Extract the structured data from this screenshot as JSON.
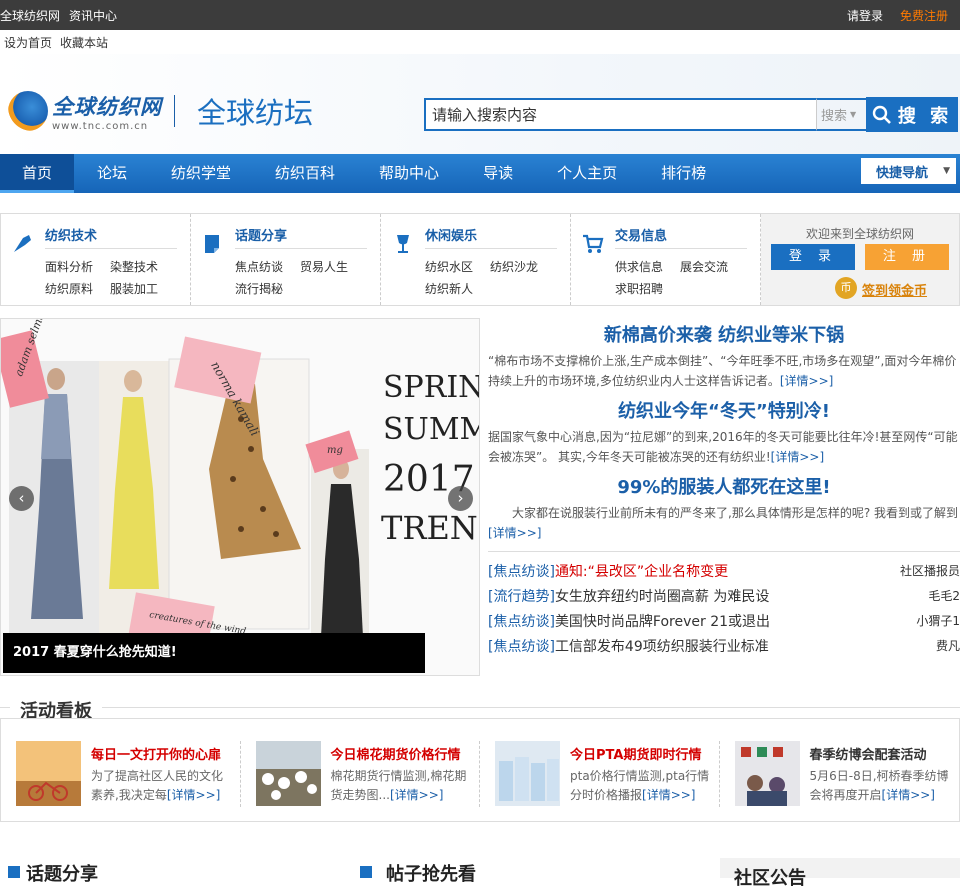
{
  "topbar": {
    "left": [
      "全球纺织网",
      "资讯中心"
    ],
    "login": "请登录",
    "register": "免费注册"
  },
  "subbar": [
    "设为首页",
    "收藏本站"
  ],
  "header": {
    "logo_cn": "全球纺织网",
    "logo_en": "www.tnc.com.cn",
    "forum_name": "全球纺坛",
    "search_value": "请输入搜索内容",
    "search_select": "搜索",
    "search_button": "搜 索"
  },
  "nav": {
    "items": [
      "首页",
      "论坛",
      "纺织学堂",
      "纺织百科",
      "帮助中心",
      "导读",
      "个人主页",
      "排行榜"
    ],
    "quick": "快捷导航"
  },
  "categories": [
    {
      "title": "纺织技术",
      "links": [
        "面料分析",
        "染整技术",
        "纺织原料",
        "服装加工"
      ]
    },
    {
      "title": "话题分享",
      "links": [
        "焦点纺谈",
        "贸易人生",
        "流行揭秘"
      ]
    },
    {
      "title": "休闲娱乐",
      "links": [
        "纺织水区",
        "纺织沙龙",
        "纺织新人"
      ]
    },
    {
      "title": "交易信息",
      "links": [
        "供求信息",
        "展会交流",
        "求职招聘"
      ]
    }
  ],
  "welcome": {
    "text": "欢迎来到全球纺织网",
    "login": "登 录",
    "register": "注 册",
    "coin": "币",
    "sign": "签到领金币"
  },
  "slider": {
    "caption": "2017 春夏穿什么抢先知道!",
    "prev": "‹",
    "next": "›",
    "art": {
      "spring": "SPRING-",
      "summer": "SUMMER",
      "year": "2017",
      "trends": "TRENDS",
      "tag1": "adam selman",
      "tag2": "norma kamali",
      "tag3": "mg",
      "tag4": "creatures of the wind"
    }
  },
  "news": [
    {
      "headline": "新棉高价来袭 纺织业等米下锅",
      "text": "“棉布市场不支撑棉价上涨,生产成本倒挂”、“今年旺季不旺,市场多在观望”,面对今年棉价持续上升的市场环境,多位纺织业内人士这样告诉记者。",
      "more": "[详情>>]"
    },
    {
      "headline": "纺织业今年“冬天”特别冷!",
      "text": "据国家气象中心消息,因为“拉尼娜”的到来,2016年的冬天可能要比往年冷!甚至网传“可能会被冻哭”。 其实,今年冬天可能被冻哭的还有纺织业!",
      "more": "[详情>>]"
    },
    {
      "headline": "99%的服装人都死在这里!",
      "text": "　　大家都在说服装行业前所未有的严冬来了,那么具体情形是怎样的呢? 我看到或了解到",
      "more": "[详情>>]"
    }
  ],
  "list": [
    {
      "tag": "[焦点纺谈]",
      "title": "通知:“县改区”企业名称变更",
      "red": true,
      "author": "社区播报员"
    },
    {
      "tag": "[流行趋势]",
      "title": "女生放弃纽约时尚圈高薪 为难民设",
      "red": false,
      "author": "毛毛2"
    },
    {
      "tag": "[焦点纺谈]",
      "title": "美国快时尚品牌Forever 21或退出",
      "red": false,
      "author": "小猬子1"
    },
    {
      "tag": "[焦点纺谈]",
      "title": "工信部发布49项纺织服装行业标准",
      "red": false,
      "author": "费凡"
    }
  ],
  "activities": {
    "title": "活动看板",
    "items": [
      {
        "title": "每日一文打开你的心扉",
        "desc": "为了提高社区人民的文化素养,我决定每",
        "more": "[详情>>]",
        "red": true
      },
      {
        "title": "今日棉花期货价格行情",
        "desc": "棉花期货行情监测,棉花期货走势图...",
        "more": "[详情>>]",
        "red": true
      },
      {
        "title": "今日PTA期货即时行情",
        "desc": "pta价格行情监测,pta行情分时价格播报",
        "more": "[详情>>]",
        "red": true
      },
      {
        "title": "春季纺博会配套活动",
        "desc": "5月6日-8日,柯桥春季纺博会将再度开启",
        "more": "[详情>>]",
        "red": false
      }
    ]
  },
  "bottom": [
    "话题分享",
    "帖子抢先看",
    "社区公告"
  ],
  "colors": {
    "brand": "#1a6fc1",
    "accent": "#f7a234",
    "red": "#d40000",
    "topbar": "#3c3c3c"
  }
}
